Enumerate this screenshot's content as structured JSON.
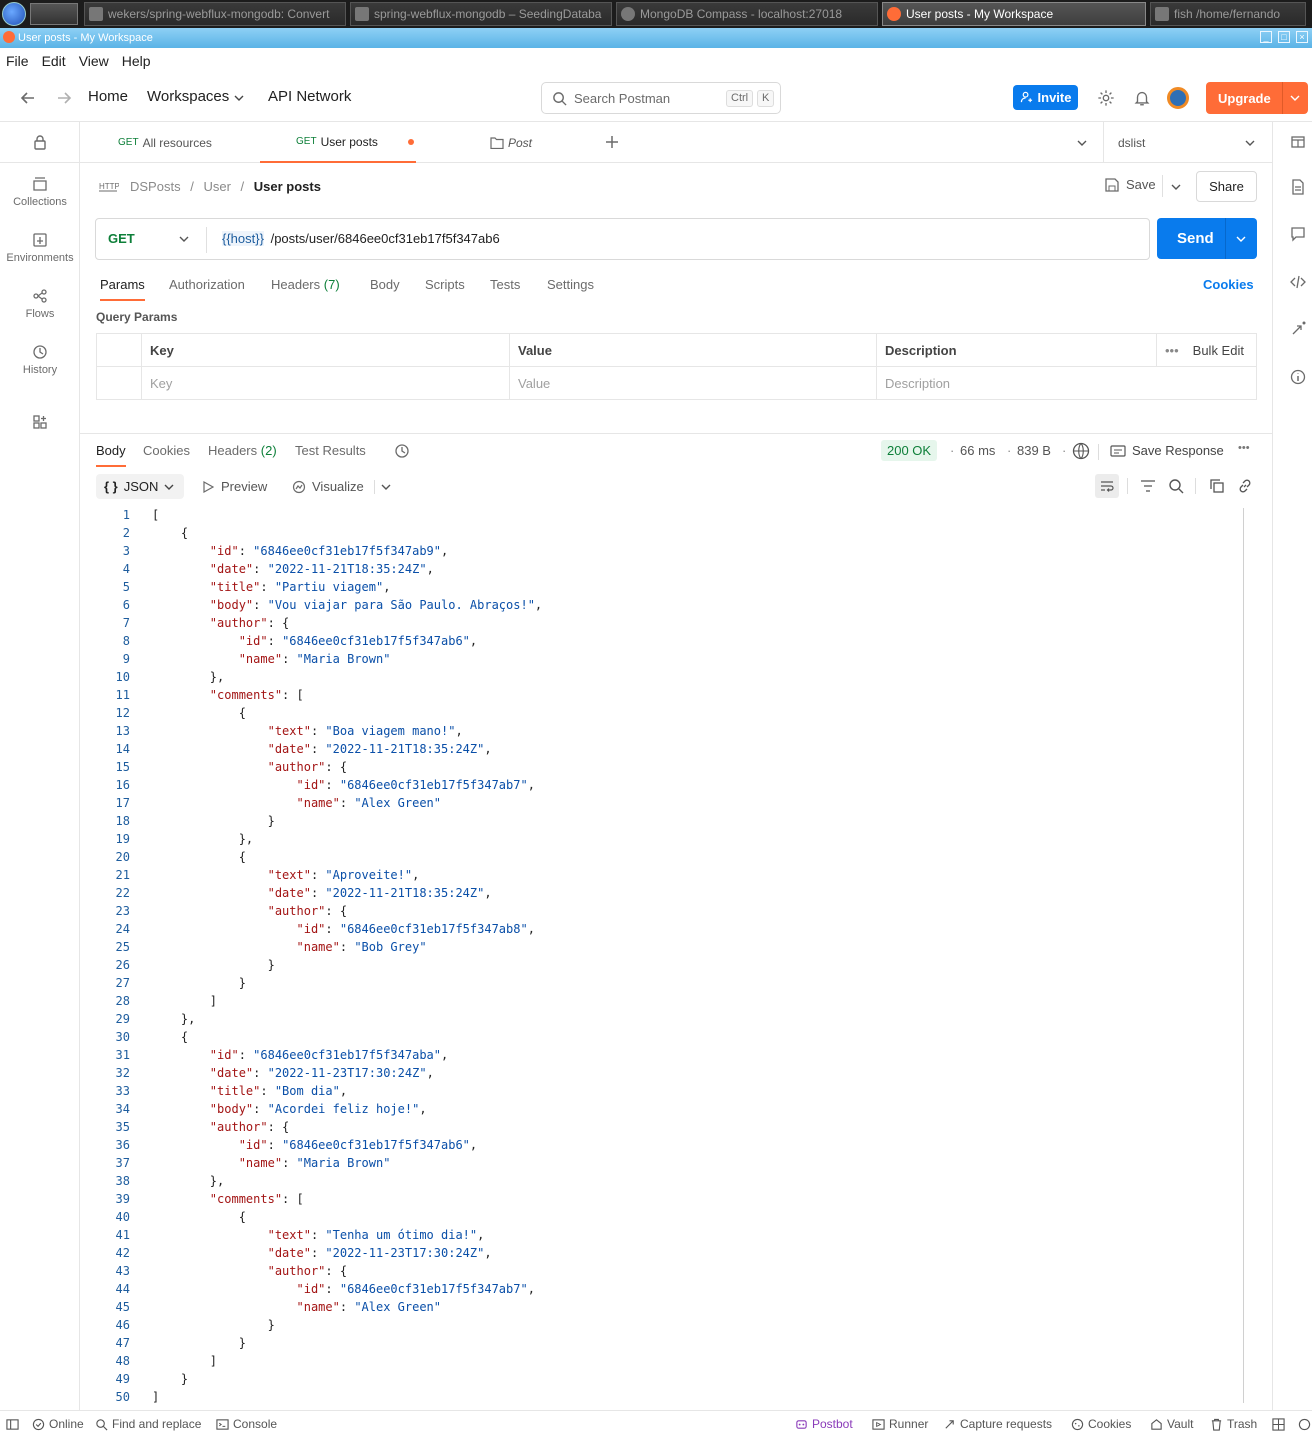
{
  "taskbar": {
    "tasks": [
      {
        "label": "wekers/spring-webflux-mongodb: Convert"
      },
      {
        "label": "spring-webflux-mongodb – SeedingDataba"
      },
      {
        "label": "MongoDB Compass - localhost:27018"
      },
      {
        "label": "User posts - My Workspace"
      },
      {
        "label": "fish /home/fernando"
      }
    ]
  },
  "window": {
    "title": "User posts - My Workspace"
  },
  "menu": [
    "File",
    "Edit",
    "View",
    "Help"
  ],
  "header": {
    "home": "Home",
    "workspaces": "Workspaces",
    "api_network": "API Network",
    "search_placeholder": "Search Postman",
    "kbd_ctrl": "Ctrl",
    "kbd_k": "K",
    "invite": "Invite",
    "upgrade": "Upgrade"
  },
  "sidebar": {
    "items": [
      {
        "label": "Collections",
        "icon": "collections-icon"
      },
      {
        "label": "Environments",
        "icon": "environments-icon"
      },
      {
        "label": "Flows",
        "icon": "flows-icon"
      },
      {
        "label": "History",
        "icon": "history-icon"
      }
    ]
  },
  "tabs": [
    {
      "method": "GET",
      "label": "All resources"
    },
    {
      "method": "GET",
      "label": "User posts",
      "unsaved": true
    },
    {
      "method": "",
      "label": "Post"
    }
  ],
  "environment": "dslist",
  "breadcrumb": {
    "root": "DSPosts",
    "folder": "User",
    "current": "User posts"
  },
  "actions": {
    "save": "Save",
    "share": "Share"
  },
  "request": {
    "method": "GET",
    "url_var": "{{host}}",
    "url_path": "/posts/user/6846ee0cf31eb17f5f347ab6",
    "send": "Send"
  },
  "request_tabs": [
    "Params",
    "Authorization",
    "Headers",
    "(7)",
    "Body",
    "Scripts",
    "Tests",
    "Settings"
  ],
  "cookies_link": "Cookies",
  "query_params": {
    "title": "Query Params",
    "headers": [
      "Key",
      "Value",
      "Description"
    ],
    "bulk_edit": "Bulk Edit",
    "placeholders": [
      "Key",
      "Value",
      "Description"
    ]
  },
  "response": {
    "tabs": [
      "Body",
      "Cookies",
      "Headers",
      "(2)",
      "Test Results"
    ],
    "status": "200 OK",
    "time": "66 ms",
    "size": "839 B",
    "save_response": "Save Response",
    "format": "JSON",
    "preview": "Preview",
    "visualize": "Visualize"
  },
  "code_lines": [
    [
      0,
      "["
    ],
    [
      1,
      "{"
    ],
    [
      2,
      "\"id\": \"6846ee0cf31eb17f5f347ab9\","
    ],
    [
      2,
      "\"date\": \"2022-11-21T18:35:24Z\","
    ],
    [
      2,
      "\"title\": \"Partiu viagem\","
    ],
    [
      2,
      "\"body\": \"Vou viajar para São Paulo. Abraços!\","
    ],
    [
      2,
      "\"author\": {"
    ],
    [
      3,
      "\"id\": \"6846ee0cf31eb17f5f347ab6\","
    ],
    [
      3,
      "\"name\": \"Maria Brown\""
    ],
    [
      2,
      "},"
    ],
    [
      2,
      "\"comments\": ["
    ],
    [
      3,
      "{"
    ],
    [
      4,
      "\"text\": \"Boa viagem mano!\","
    ],
    [
      4,
      "\"date\": \"2022-11-21T18:35:24Z\","
    ],
    [
      4,
      "\"author\": {"
    ],
    [
      5,
      "\"id\": \"6846ee0cf31eb17f5f347ab7\","
    ],
    [
      5,
      "\"name\": \"Alex Green\""
    ],
    [
      4,
      "}"
    ],
    [
      3,
      "},"
    ],
    [
      3,
      "{"
    ],
    [
      4,
      "\"text\": \"Aproveite!\","
    ],
    [
      4,
      "\"date\": \"2022-11-21T18:35:24Z\","
    ],
    [
      4,
      "\"author\": {"
    ],
    [
      5,
      "\"id\": \"6846ee0cf31eb17f5f347ab8\","
    ],
    [
      5,
      "\"name\": \"Bob Grey\""
    ],
    [
      4,
      "}"
    ],
    [
      3,
      "}"
    ],
    [
      2,
      "]"
    ],
    [
      1,
      "},"
    ],
    [
      1,
      "{"
    ],
    [
      2,
      "\"id\": \"6846ee0cf31eb17f5f347aba\","
    ],
    [
      2,
      "\"date\": \"2022-11-23T17:30:24Z\","
    ],
    [
      2,
      "\"title\": \"Bom dia\","
    ],
    [
      2,
      "\"body\": \"Acordei feliz hoje!\","
    ],
    [
      2,
      "\"author\": {"
    ],
    [
      3,
      "\"id\": \"6846ee0cf31eb17f5f347ab6\","
    ],
    [
      3,
      "\"name\": \"Maria Brown\""
    ],
    [
      2,
      "},"
    ],
    [
      2,
      "\"comments\": ["
    ],
    [
      3,
      "{"
    ],
    [
      4,
      "\"text\": \"Tenha um ótimo dia!\","
    ],
    [
      4,
      "\"date\": \"2022-11-23T17:30:24Z\","
    ],
    [
      4,
      "\"author\": {"
    ],
    [
      5,
      "\"id\": \"6846ee0cf31eb17f5f347ab7\","
    ],
    [
      5,
      "\"name\": \"Alex Green\""
    ],
    [
      4,
      "}"
    ],
    [
      3,
      "}"
    ],
    [
      2,
      "]"
    ],
    [
      1,
      "}"
    ],
    [
      0,
      "]"
    ]
  ],
  "status_bar": {
    "online": "Online",
    "find": "Find and replace",
    "console": "Console",
    "postbot": "Postbot",
    "runner": "Runner",
    "capture": "Capture requests",
    "cookies": "Cookies",
    "vault": "Vault",
    "trash": "Trash"
  },
  "colors": {
    "accent": "#097bed",
    "brand": "#ff6c37",
    "status_ok": "#0d7f39"
  }
}
